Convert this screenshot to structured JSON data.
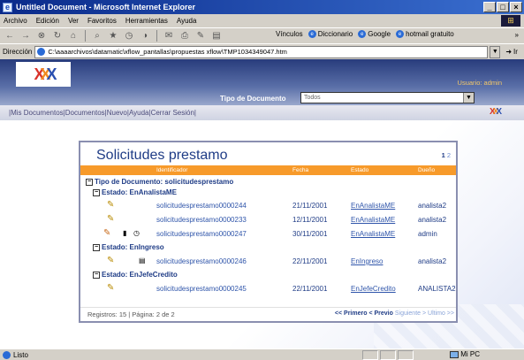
{
  "window": {
    "title": "Untitled Document - Microsoft Internet Explorer",
    "controls": [
      "_",
      "□",
      "×"
    ]
  },
  "menu": [
    "Archivo",
    "Edición",
    "Ver",
    "Favoritos",
    "Herramientas",
    "Ayuda"
  ],
  "toolbar": {
    "links": [
      "Vínculos",
      "Diccionario",
      "Google",
      "hotmail gratuito"
    ],
    "chevron": "»"
  },
  "address": {
    "label": "Dirección",
    "value": "C:\\aaaarchivos\\datamatic\\xflow_pantallas\\propuestas xflow\\TMP1034349047.htm",
    "go": "Ir"
  },
  "app": {
    "tipo_label": "Tipo de Documento",
    "tipo_value": "Todos",
    "usuario": "Usuario: admin",
    "nav": [
      "Mis Documentos",
      "Documentos",
      "Nuevo",
      "Ayuda",
      "Cerrar Sesión"
    ]
  },
  "panel": {
    "title": "Solicitudes prestamo",
    "page_current": "1",
    "page_other": "2",
    "headers": [
      "Identificador",
      "Fecha",
      "Estado",
      "Dueño"
    ],
    "tipo_group": "Tipo de Documento: solicitudesprestamo",
    "groups": [
      {
        "label": "Estado: EnAnalistaME",
        "rows": [
          {
            "id": "solicitudesprestamo0000244",
            "fecha": "21/11/2001",
            "estado": "EnAnalistaME",
            "dueno": "analista2"
          },
          {
            "id": "solicitudesprestamo0000233",
            "fecha": "12/11/2001",
            "estado": "EnAnalistaME",
            "dueno": "analista2"
          },
          {
            "id": "solicitudesprestamo0000247",
            "fecha": "30/11/2001",
            "estado": "EnAnalistaME",
            "dueno": "admin"
          }
        ]
      },
      {
        "label": "Estado: EnIngreso",
        "rows": [
          {
            "id": "solicitudesprestamo0000246",
            "fecha": "22/11/2001",
            "estado": "EnIngreso",
            "dueno": "analista2"
          }
        ]
      },
      {
        "label": "Estado: EnJefeCredito",
        "rows": [
          {
            "id": "solicitudesprestamo0000245",
            "fecha": "22/11/2001",
            "estado": "EnJefeCredito",
            "dueno": "ANALISTA2"
          }
        ]
      }
    ],
    "footer_left": "Registros: 15 | Página: 2 de 2",
    "nav_primero": "<< Primero",
    "nav_previo": "< Previo",
    "nav_siguiente": "Siguiente >",
    "nav_ultimo": "Ultimo >>"
  },
  "status": {
    "text": "Listo",
    "zone": "Mi PC"
  }
}
